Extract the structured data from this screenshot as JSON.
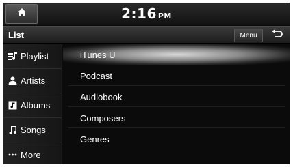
{
  "status": {
    "time": "2:16",
    "ampm": "PM"
  },
  "titlebar": {
    "title": "List",
    "menu_label": "Menu"
  },
  "sidebar": {
    "items": [
      {
        "label": "Playlist",
        "icon": "playlist-icon"
      },
      {
        "label": "Artists",
        "icon": "artist-icon"
      },
      {
        "label": "Albums",
        "icon": "album-icon"
      },
      {
        "label": "Songs",
        "icon": "music-note-icon"
      },
      {
        "label": "More",
        "icon": "more-icon"
      }
    ]
  },
  "list": {
    "items": [
      {
        "label": "iTunes U",
        "selected": true
      },
      {
        "label": "Podcast"
      },
      {
        "label": "Audiobook"
      },
      {
        "label": "Composers"
      },
      {
        "label": "Genres"
      }
    ]
  }
}
